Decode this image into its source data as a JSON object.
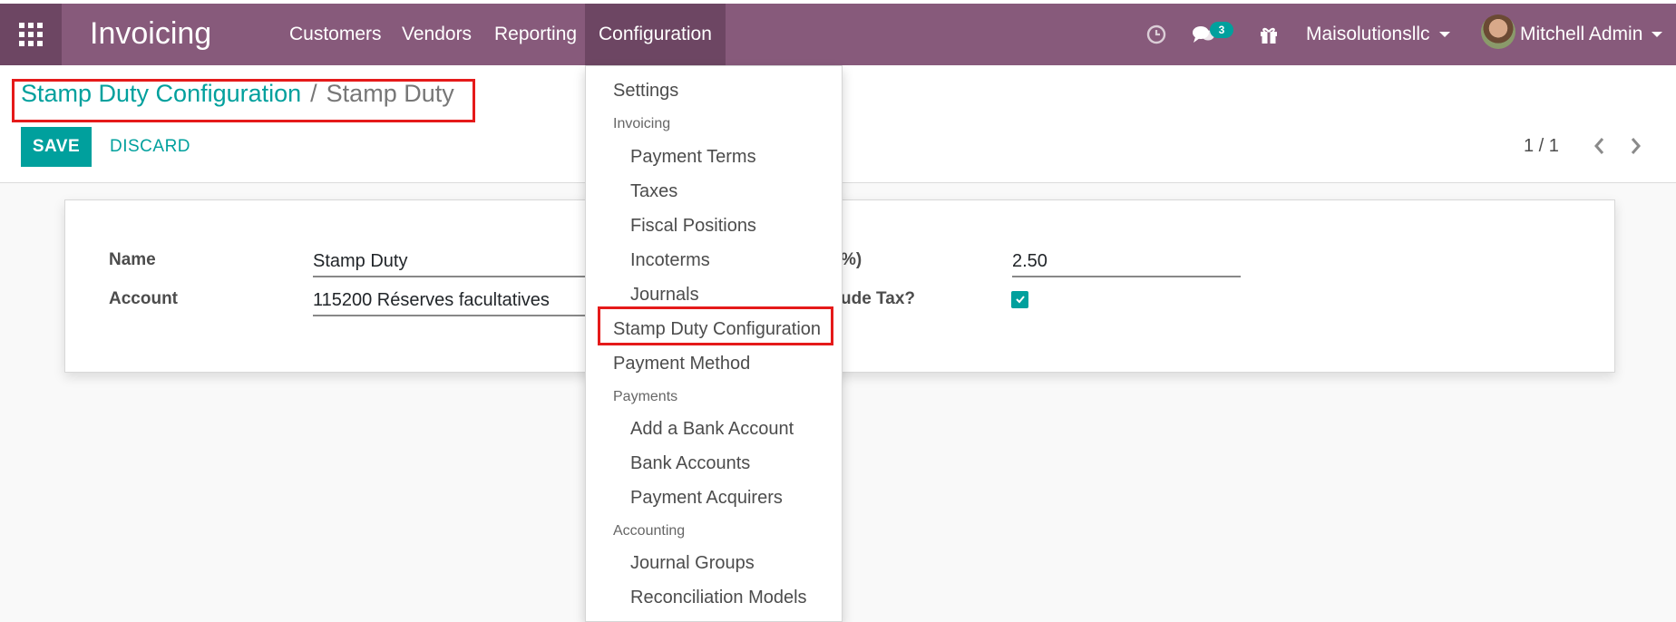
{
  "topbar": {
    "app_title": "Invoicing",
    "menu": [
      "Customers",
      "Vendors",
      "Reporting",
      "Configuration"
    ],
    "message_count": "3",
    "company": "Maisolutionsllc",
    "user": "Mitchell Admin",
    "accent": "#875a7b"
  },
  "breadcrumb": {
    "parent": "Stamp Duty Configuration",
    "separator": "/",
    "current": "Stamp Duty"
  },
  "actions": {
    "save": "SAVE",
    "discard": "DISCARD"
  },
  "pager": {
    "text": "1 / 1"
  },
  "form": {
    "name_label": "Name",
    "name_value": "Stamp Duty",
    "account_label": "Account",
    "account_value": "115200 Réserves facultatives",
    "percent_label_visible": "%)",
    "percent_value": "2.50",
    "exclude_label_visible": "ude Tax?",
    "exclude_checked": true
  },
  "config_menu": {
    "settings": "Settings",
    "invoicing_header": "Invoicing",
    "payment_terms": "Payment Terms",
    "taxes": "Taxes",
    "fiscal_positions": "Fiscal Positions",
    "incoterms": "Incoterms",
    "journals": "Journals",
    "stamp_duty": "Stamp Duty Configuration",
    "payment_method": "Payment Method",
    "payments_header": "Payments",
    "add_bank": "Add a Bank Account",
    "bank_accounts": "Bank Accounts",
    "payment_acquirers": "Payment Acquirers",
    "accounting_header": "Accounting",
    "journal_groups": "Journal Groups",
    "reconciliation_models": "Reconciliation Models"
  }
}
